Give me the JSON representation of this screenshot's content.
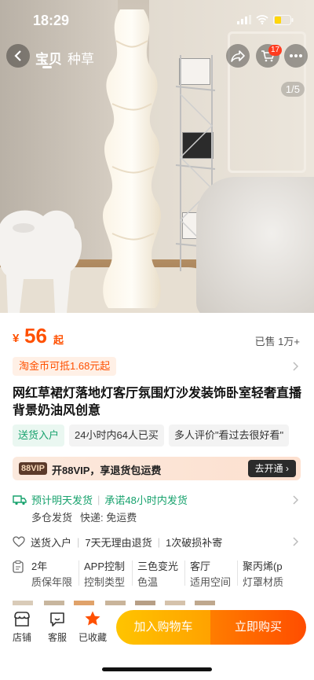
{
  "status_bar": {
    "time": "18:29"
  },
  "nav": {
    "tabs": [
      "宝贝",
      "种草"
    ],
    "active_tab": "宝贝",
    "cart_count": "17"
  },
  "gallery": {
    "pager": "1/5"
  },
  "product": {
    "currency": "¥",
    "price": "56",
    "price_suffix": "起",
    "sold": "已售 1万+",
    "coin_offer": "淘金币可抵1.68元起",
    "title": "网红草裙灯落地灯客厅氛围灯沙发装饰卧室轻奢直播背景奶油风创意",
    "tags": [
      "送货入户",
      "24小时内64人已买",
      "多人评价\"看过去很好看\""
    ]
  },
  "vip": {
    "badge": "88VIP",
    "text": "开88VIP，享退货包运费",
    "button": "去开通 ›"
  },
  "shipping": {
    "line1_a": "预计明天发货",
    "line1_b": "承诺48小时内发货",
    "line2_a": "多仓发货",
    "line2_b": "快递: 免运费"
  },
  "services": [
    "送货入户",
    "7天无理由退货",
    "1次破损补寄"
  ],
  "attributes": [
    {
      "value": "2年",
      "key": "质保年限"
    },
    {
      "value": "APP控制",
      "key": "控制类型"
    },
    {
      "value": "三色变光",
      "key": "色温"
    },
    {
      "value": "客厅",
      "key": "适用空间"
    },
    {
      "value": "聚丙烯(p",
      "key": "灯罩材质"
    }
  ],
  "bottom_bar": {
    "shop": "店铺",
    "service": "客服",
    "favorited": "已收藏",
    "add_cart": "加入购物车",
    "buy_now": "立即购买"
  },
  "colors": {
    "accent": "#ff5000",
    "green": "#17a26d",
    "cart_yellow": "#ffb300",
    "buy_orange": "#ff5f00"
  }
}
